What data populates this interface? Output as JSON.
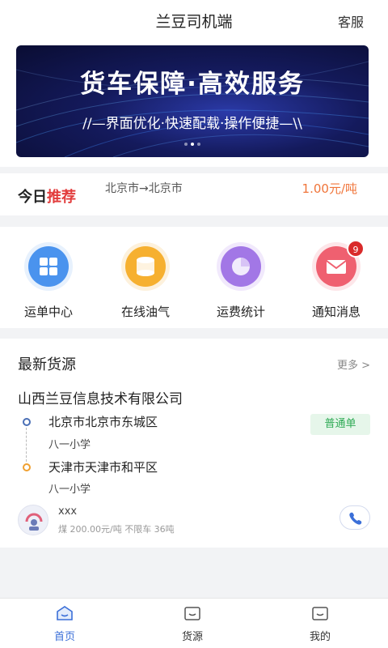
{
  "header": {
    "title": "兰豆司机端",
    "service_label": "客服"
  },
  "banner": {
    "headline": "货车保障·高效服务",
    "tagline": "//—界面优化·快速配载·操作便捷—\\\\",
    "slide_count": 3,
    "active_slide": 2
  },
  "recommend": {
    "tag_part1": "今日",
    "tag_part2": "推荐",
    "route": "北京市→北京市",
    "price": "1.00元/吨"
  },
  "menu": {
    "items": [
      {
        "label": "运单中心",
        "icon": "grid-icon",
        "color": "#3a86e8"
      },
      {
        "label": "在线油气",
        "icon": "oil-barrel-icon",
        "color": "#f5a623"
      },
      {
        "label": "运费统计",
        "icon": "pie-chart-icon",
        "color": "#9b6be0"
      },
      {
        "label": "通知消息",
        "icon": "envelope-icon",
        "color": "#ef5a6a",
        "badge": "9"
      }
    ]
  },
  "cargo": {
    "section_title": "最新货源",
    "more_label": "更多 >",
    "company": "山西兰豆信息技术有限公司",
    "from_city": "北京市北京市东城区",
    "from_place": "八一小学",
    "to_city": "天津市天津市和平区",
    "to_place": "八一小学",
    "order_type": "普通单",
    "owner_name": "xxx",
    "detail": "煤 200.00元/吨 不限车 36吨"
  },
  "tabbar": {
    "items": [
      {
        "label": "首页",
        "icon": "home-icon",
        "active": true
      },
      {
        "label": "货源",
        "icon": "cargo-icon",
        "active": false
      },
      {
        "label": "我的",
        "icon": "profile-icon",
        "active": false
      }
    ]
  }
}
